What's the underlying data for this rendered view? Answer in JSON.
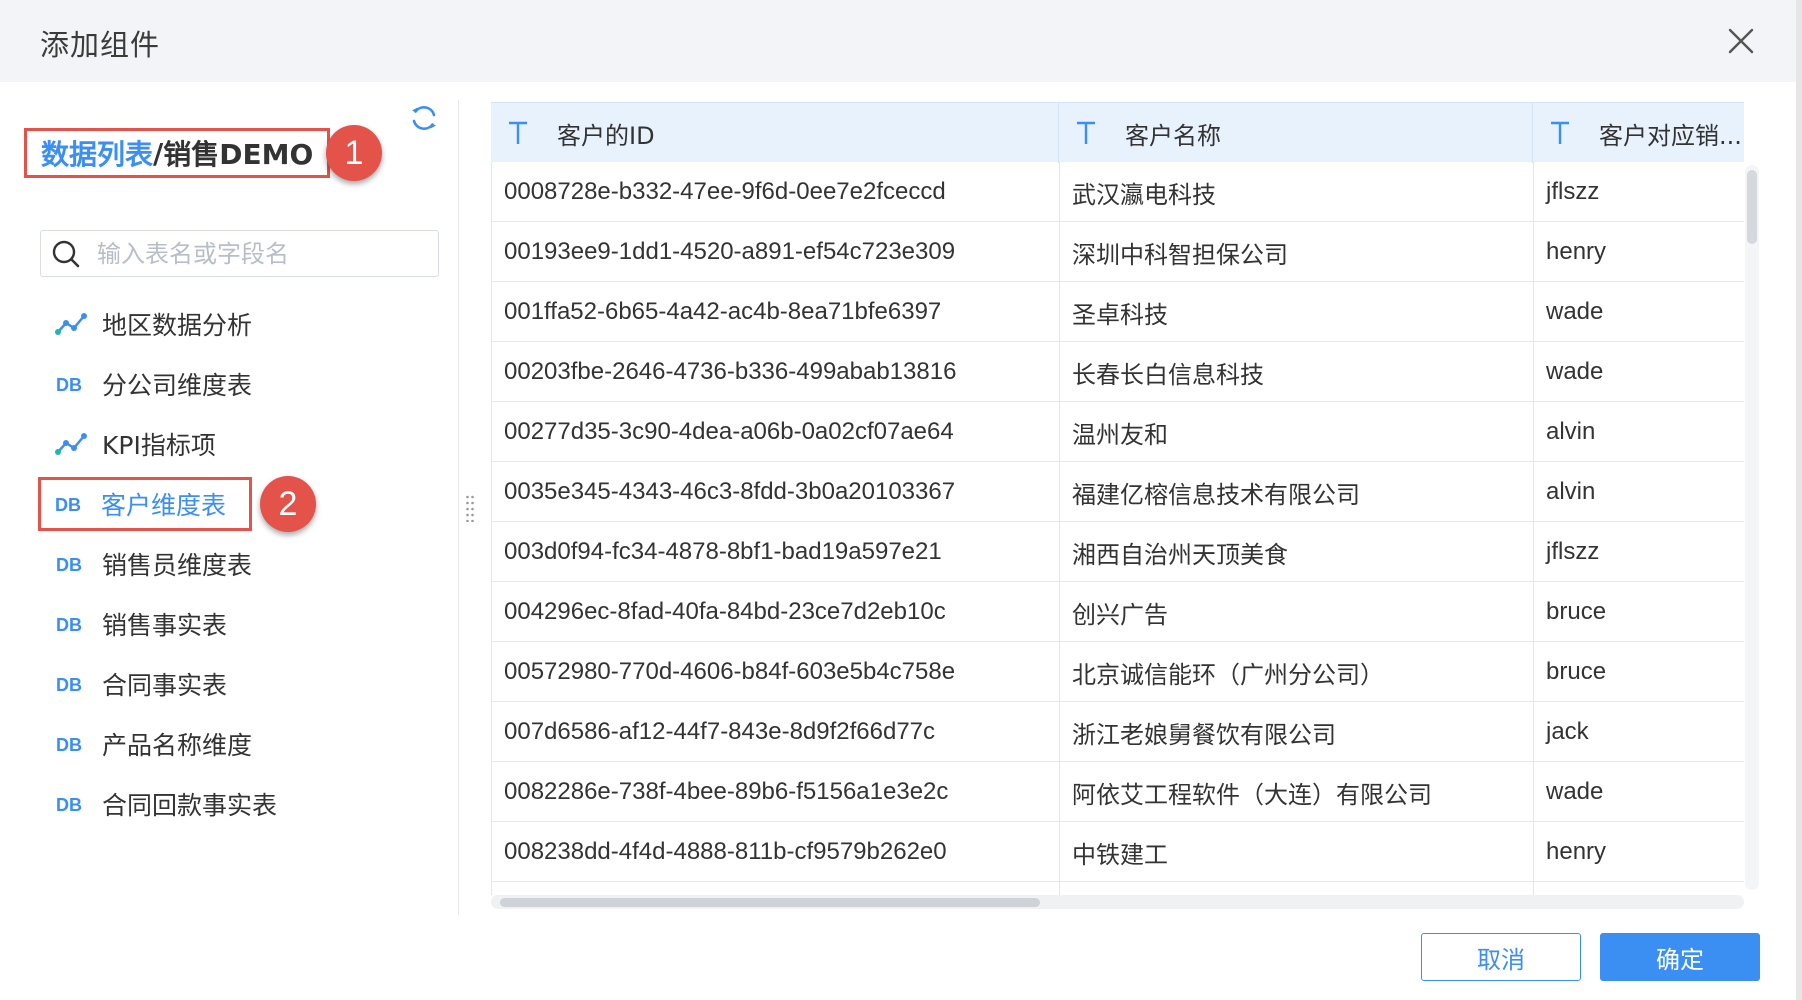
{
  "dialog": {
    "title": "添加组件"
  },
  "breadcrumb": {
    "link": "数据列表",
    "separator": "/",
    "current": "销售DEMO"
  },
  "annotations": {
    "badge1": "1",
    "badge2": "2"
  },
  "search": {
    "placeholder": "输入表名或字段名"
  },
  "table_list": [
    {
      "label": "地区数据分析",
      "icon": "analysis-icon"
    },
    {
      "label": "分公司维度表",
      "icon": "db-icon"
    },
    {
      "label": "KPI指标项",
      "icon": "analysis-icon"
    },
    {
      "label": "客户维度表",
      "icon": "db-icon",
      "active": true
    },
    {
      "label": "销售员维度表",
      "icon": "db-icon"
    },
    {
      "label": "销售事实表",
      "icon": "db-icon"
    },
    {
      "label": "合同事实表",
      "icon": "db-icon"
    },
    {
      "label": "产品名称维度",
      "icon": "db-icon"
    },
    {
      "label": "合同回款事实表",
      "icon": "db-icon"
    }
  ],
  "grid": {
    "columns": [
      "客户的ID",
      "客户名称",
      "客户对应销..."
    ],
    "column_type_icon": "text-type-icon",
    "rows": [
      [
        "0008728e-b332-47ee-9f6d-0ee7e2fcecсd",
        "武汉瀛电科技",
        "jflszz"
      ],
      [
        "00193ee9-1dd1-4520-a891-ef54c723e309",
        "深圳中科智担保公司",
        "henry"
      ],
      [
        "001ffa52-6b65-4a42-ac4b-8ea71bfe6397",
        "圣卓科技",
        "wade"
      ],
      [
        "00203fbe-2646-4736-b336-499abab13816",
        "长春长白信息科技",
        "wade"
      ],
      [
        "00277d35-3c90-4dea-a06b-0a02cf07ae64",
        "温州友和",
        "alvin"
      ],
      [
        "0035e345-4343-46c3-8fdd-3b0a20103367",
        "福建亿榕信息技术有限公司",
        "alvin"
      ],
      [
        "003d0f94-fc34-4878-8bf1-bad19a597e21",
        "湘西自治州天顶美食",
        "jflszz"
      ],
      [
        "004296ec-8fad-40fa-84bd-23ce7d2eb10c",
        "创兴广告",
        "bruce"
      ],
      [
        "00572980-770d-4606-b84f-603e5b4c758e",
        "北京诚信能环（广州分公司）",
        "bruce"
      ],
      [
        "007d6586-af12-44f7-843e-8d9f2f66d77c",
        "浙江老娘舅餐饮有限公司",
        "jack"
      ],
      [
        "0082286e-738f-4bee-89b6-f5156a1e3e2c",
        "阿依艾工程软件（大连）有限公司",
        "wade"
      ],
      [
        "008238dd-4f4d-4888-811b-cf9579b262e0",
        "中铁建工",
        "henry"
      ],
      [
        "",
        "",
        ""
      ]
    ]
  },
  "footer": {
    "cancel_label": "取消",
    "ok_label": "确定"
  },
  "colors": {
    "accent": "#3b8ef2",
    "annotation": "#e3534a",
    "header_bg": "#f2f4f7",
    "grid_header_bg": "#e8f2fc"
  }
}
